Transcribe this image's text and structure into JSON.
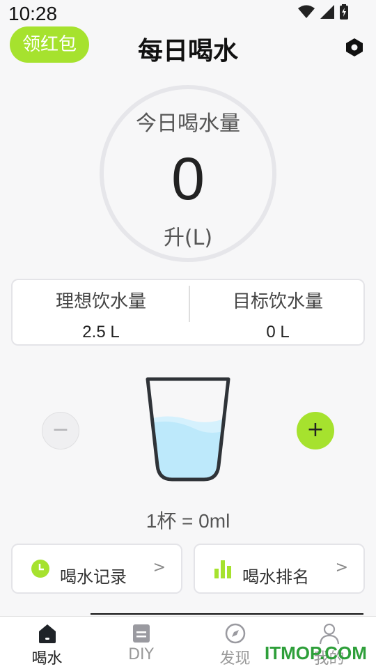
{
  "status": {
    "time": "10:28"
  },
  "header": {
    "redpacket_label": "领红包",
    "title": "每日喝水"
  },
  "today": {
    "label": "今日喝水量",
    "value": "0",
    "unit": "升(L)"
  },
  "intake": {
    "ideal_label": "理想饮水量",
    "ideal_value": "2.5 L",
    "target_label": "目标饮水量",
    "target_value": "0 L"
  },
  "cup": {
    "minus_label": "−",
    "plus_label": "+",
    "conversion": "1杯 = 0ml"
  },
  "actions": [
    {
      "label": "喝水记录",
      "icon": "clock-icon"
    },
    {
      "label": "喝水排名",
      "icon": "bar-chart-icon"
    }
  ],
  "nav": [
    {
      "label": "喝水",
      "icon": "home-icon"
    },
    {
      "label": "DIY",
      "icon": "document-icon"
    },
    {
      "label": "发现",
      "icon": "compass-icon"
    },
    {
      "label": "我的",
      "icon": "user-icon"
    }
  ],
  "watermark": "ITMOP.COM",
  "colors": {
    "accent": "#a6e22e",
    "water": "#bfeafc",
    "watermark": "#2e9f3a"
  }
}
